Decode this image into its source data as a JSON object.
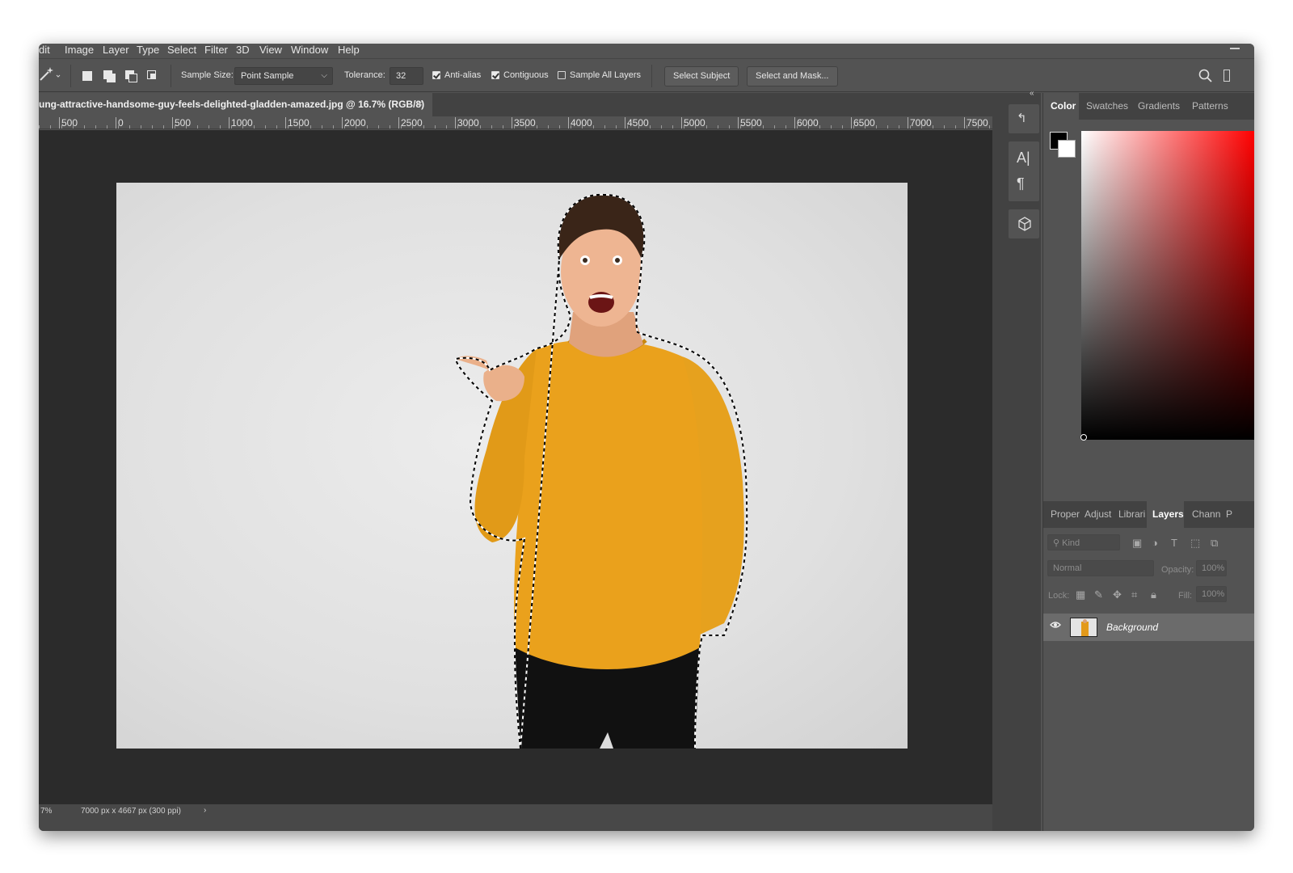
{
  "menu": {
    "items": [
      "dit",
      "Image",
      "Layer",
      "Type",
      "Select",
      "Filter",
      "3D",
      "View",
      "Window",
      "Help"
    ]
  },
  "options_bar": {
    "tool_icon": "magic-wand-icon",
    "sample_size_label": "Sample Size:",
    "sample_size_value": "Point Sample",
    "tolerance_label": "Tolerance:",
    "tolerance_value": "32",
    "anti_alias": {
      "label": "Anti-alias",
      "checked": true
    },
    "contiguous": {
      "label": "Contiguous",
      "checked": true
    },
    "sample_all_layers": {
      "label": "Sample All Layers",
      "checked": false
    },
    "select_subject": "Select Subject",
    "select_and_mask": "Select and Mask..."
  },
  "document": {
    "tab_title": "ung-attractive-handsome-guy-feels-delighted-gladden-amazed.jpg @ 16.7% (RGB/8)",
    "close_glyph": "×"
  },
  "ruler": {
    "labels": [
      "500",
      "0",
      "500",
      "1000",
      "1500",
      "2000",
      "2500",
      "3000",
      "3500",
      "4000",
      "4500",
      "5000",
      "5500",
      "6000",
      "6500",
      "7000",
      "7500"
    ]
  },
  "status": {
    "zoom": "7%",
    "doc_size": "7000 px x 4667 px (300 ppi)",
    "arrow": "›"
  },
  "color_panel": {
    "tabs": [
      "Color",
      "Swatches",
      "Gradients",
      "Patterns"
    ],
    "active_tab": "Color",
    "foreground": "#000000",
    "background": "#ffffff",
    "picker_hue": "#ff0000"
  },
  "layers_panel": {
    "tabs": [
      "Proper",
      "Adjust",
      "Librari",
      "Layers",
      "Chann",
      "P"
    ],
    "active_tab": "Layers",
    "filter_placeholder": "Kind",
    "blend_mode": "Normal",
    "opacity_label": "Opacity:",
    "opacity_value": "100%",
    "lock_label": "Lock:",
    "fill_label": "Fill:",
    "fill_value": "100%",
    "layers": [
      {
        "name": "Background",
        "visible": true
      }
    ]
  }
}
